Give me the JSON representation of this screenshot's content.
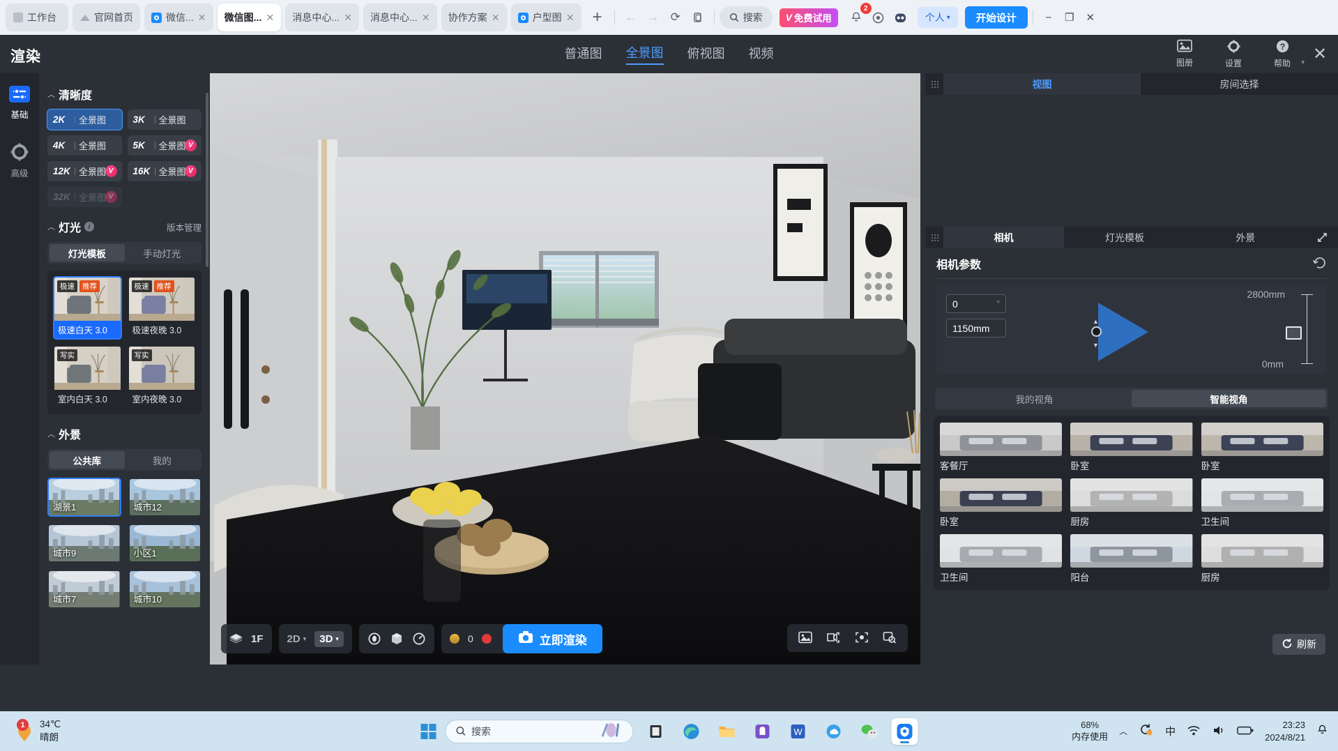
{
  "browser": {
    "tabs": [
      {
        "label": "工作台",
        "icon": "workbench-icon",
        "closable": false,
        "active": false
      },
      {
        "label": "官网首页",
        "icon": "home-icon",
        "closable": false,
        "active": false
      },
      {
        "label": "微信...",
        "icon": "wechat-icon",
        "closable": true,
        "active": false
      },
      {
        "label": "微信图...",
        "icon": "none",
        "closable": true,
        "active": true
      },
      {
        "label": "消息中心...",
        "icon": "none",
        "closable": true,
        "active": false
      },
      {
        "label": "消息中心...",
        "icon": "none",
        "closable": true,
        "active": false
      },
      {
        "label": "协作方案",
        "icon": "none",
        "closable": true,
        "active": false
      },
      {
        "label": "户型图",
        "icon": "wechat-icon",
        "closable": true,
        "active": false
      }
    ],
    "new_tab_label": "+",
    "nav": {
      "back": "←",
      "forward": "→",
      "reload": "⟳",
      "copy": "copy-icon"
    },
    "search_label": "搜索",
    "trial_label": "免费试用",
    "trial_prefix": "V",
    "notification_count": "2",
    "user_label": "个人",
    "start_design_label": "开始设计",
    "window_controls": {
      "minimize": "−",
      "maximize": "❐",
      "close": "✕"
    }
  },
  "header": {
    "title": "渲染",
    "mode_tabs": [
      {
        "label": "普通图",
        "active": false
      },
      {
        "label": "全景图",
        "active": true
      },
      {
        "label": "俯视图",
        "active": false
      },
      {
        "label": "视频",
        "active": false
      }
    ],
    "actions": [
      {
        "label": "图册",
        "icon": "album-icon"
      },
      {
        "label": "设置",
        "icon": "gear-icon"
      },
      {
        "label": "帮助",
        "icon": "help-icon"
      }
    ],
    "close_label": "✕"
  },
  "rail": {
    "items": [
      {
        "label": "基础",
        "icon": "sliders-icon",
        "active": true
      },
      {
        "label": "高级",
        "icon": "gear-icon",
        "active": false
      }
    ]
  },
  "clarity": {
    "title": "清晰度",
    "options": [
      {
        "k": "2K",
        "name": "全景图",
        "tag": "bar",
        "selected": true,
        "disabled": false
      },
      {
        "k": "3K",
        "name": "全景图",
        "tag": "bar",
        "selected": false,
        "disabled": false
      },
      {
        "k": "4K",
        "name": "全景图",
        "tag": "bar",
        "selected": false,
        "disabled": false
      },
      {
        "k": "5K",
        "name": "全景图",
        "tag": "vip",
        "selected": false,
        "disabled": false
      },
      {
        "k": "12K",
        "name": "全景图",
        "tag": "vip",
        "selected": false,
        "disabled": false
      },
      {
        "k": "16K",
        "name": "全景图",
        "tag": "vip",
        "selected": false,
        "disabled": false
      },
      {
        "k": "32K",
        "name": "全景图",
        "tag": "vip",
        "selected": false,
        "disabled": true
      }
    ]
  },
  "lighting": {
    "title": "灯光",
    "version_link": "版本管理",
    "tabs": [
      {
        "label": "灯光模板",
        "active": true
      },
      {
        "label": "手动灯光",
        "active": false
      }
    ],
    "templates": [
      {
        "caption": "极速白天 3.0",
        "badges": [
          "极速",
          "推荐"
        ],
        "selected": true,
        "c1": "#d8d2c8",
        "c2": "#6e757a"
      },
      {
        "caption": "极速夜晚 3.0",
        "badges": [
          "极速",
          "推荐"
        ],
        "selected": false,
        "c1": "#cfcabf",
        "c2": "#7b7fa3"
      },
      {
        "caption": "室内白天 3.0",
        "badges": [
          "写实"
        ],
        "selected": false,
        "c1": "#d5cfc5",
        "c2": "#707779"
      },
      {
        "caption": "室内夜晚 3.0",
        "badges": [
          "写实"
        ],
        "selected": false,
        "c1": "#cbc6bc",
        "c2": "#7a7ea0"
      }
    ]
  },
  "exterior": {
    "title": "外景",
    "tabs": [
      {
        "label": "公共库",
        "active": true
      },
      {
        "label": "我的",
        "active": false
      }
    ],
    "items": [
      {
        "caption": "湖景1",
        "selected": true,
        "sky": "#b9cfe0",
        "ground": "#6b7a63"
      },
      {
        "caption": "城市12",
        "selected": false,
        "sky": "#a9c6df",
        "ground": "#5d7060"
      },
      {
        "caption": "城市9",
        "selected": false,
        "sky": "#b5c6d6",
        "ground": "#6d7a74"
      },
      {
        "caption": "小区1",
        "selected": false,
        "sky": "#9ab8d4",
        "ground": "#5a6f58"
      },
      {
        "caption": "城市7",
        "selected": false,
        "sky": "#c2ccd6",
        "ground": "#737d72"
      },
      {
        "caption": "城市10",
        "selected": false,
        "sky": "#a7c2da",
        "ground": "#64745f"
      }
    ]
  },
  "viewport": {
    "floor_label": "1F",
    "layers_icon": "layers-icon",
    "view_2d": "2D",
    "view_3d": "3D",
    "tool_icons": [
      "target-icon",
      "cube-icon",
      "gauge-icon"
    ],
    "credit_count": "0",
    "render_button": "立即渲染",
    "camera_icon": "camera-icon",
    "right_tools": [
      "image-icon",
      "screenshot-icon",
      "focus-icon",
      "zoom-search-icon"
    ]
  },
  "right_top": {
    "tabs": [
      {
        "label": "视图",
        "active": true
      },
      {
        "label": "房间选择",
        "active": false
      }
    ],
    "expand_icon": "expand-icon"
  },
  "right_bottom": {
    "tabs": [
      {
        "label": "相机",
        "active": true
      },
      {
        "label": "灯光模板",
        "active": false
      },
      {
        "label": "外景",
        "active": false
      }
    ],
    "expand_icon": "expand-icon",
    "camera": {
      "title": "相机参数",
      "reset_icon": "reset-icon",
      "angle_value": "0",
      "angle_unit": "°",
      "height_value": "1150mm",
      "max_label": "2800mm",
      "min_label": "0mm"
    },
    "viewpoint_tabs": [
      {
        "label": "我的视角",
        "active": false
      },
      {
        "label": "智能视角",
        "active": true
      }
    ],
    "viewpoints": [
      {
        "caption": "客餐厅",
        "a": "#c9c9ca",
        "b": "#8e9296"
      },
      {
        "caption": "卧室",
        "a": "#b9b2a8",
        "b": "#3c4254"
      },
      {
        "caption": "卧室",
        "a": "#bdb6ac",
        "b": "#3d4356"
      },
      {
        "caption": "卧室",
        "a": "#b3aca2",
        "b": "#3a4052"
      },
      {
        "caption": "厨房",
        "a": "#dcdcdc",
        "b": "#b3b3b3"
      },
      {
        "caption": "卫生间",
        "a": "#e2e4e6",
        "b": "#a9adb1"
      },
      {
        "caption": "卫生间",
        "a": "#e0e2e4",
        "b": "#a7abb0"
      },
      {
        "caption": "阳台",
        "a": "#cfd8e0",
        "b": "#8d969e"
      },
      {
        "caption": "厨房",
        "a": "#dedede",
        "b": "#b0b0b0"
      }
    ],
    "refresh_label": "刷新",
    "refresh_icon": "refresh-icon"
  },
  "taskbar": {
    "weather_temp": "34℃",
    "weather_desc": "晴朗",
    "weather_badge": "1",
    "search_placeholder": "搜索",
    "memory_percent": "68%",
    "memory_label": "内存使用",
    "time": "23:23",
    "date": "2024/8/21",
    "ime_label": "中",
    "chevron": "︿"
  }
}
